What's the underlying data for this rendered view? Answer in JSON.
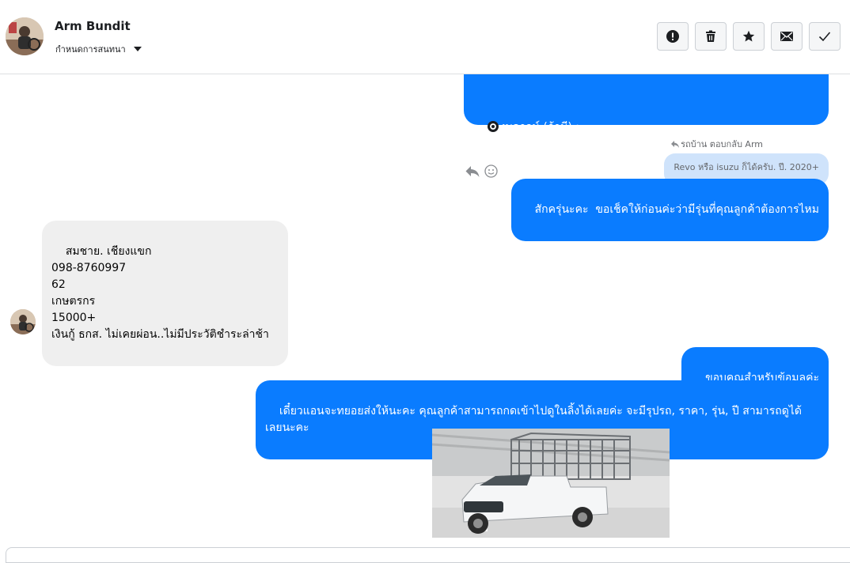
{
  "header": {
    "contact_name": "Arm Bundit",
    "manage_label": "กำหนดการสนทนา",
    "toolbar": [
      "alert-icon",
      "trash-icon",
      "star-icon",
      "envelope-icon",
      "check-icon"
    ]
  },
  "messages": {
    "top_outgoing_text": "งบดาวน์ (ถ้ามี) :",
    "reply_meta": "รถบ้าน ตอบกลับ Arm",
    "quoted_text": "Revo หรือ isuzu ก็ได้ครับ. ปี. 2020+",
    "outgoing_1": "สักครุ่นะคะ  ขอเช็คให้ก่อนค่ะว่ามีรุ่นที่คุณลูกค้าต้องการไหม",
    "incoming_1": "สมชาย. เชียงแขก\n098-8760997\n62\nเกษตรกร\n15000+\nเงินกู้ ธกส. ไม่เคยผ่อน..ไม่มีประวัติชำระล่าช้า",
    "outgoing_2": "ขอบคุณสำหรับข้อมูลค่ะ",
    "outgoing_3": "เดี๋ยวแอนจะทยอยส่งให้นะคะ คุณลูกค้าสามารถกดเข้าไปดูในลิ้งได้เลยค่ะ จะมีรุปรถ, ราคา, รุ่น, ปี สามารถดูได้\nเลยนะคะ"
  },
  "colors": {
    "outgoing": "#0a7cff",
    "incoming": "#efefef",
    "quoted": "#cfe3fb"
  }
}
